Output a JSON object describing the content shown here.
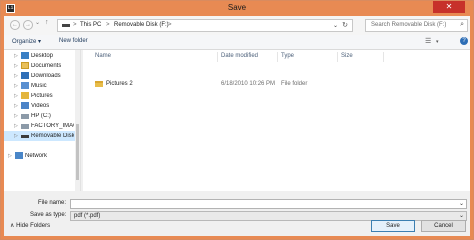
{
  "window": {
    "title": "Save",
    "app_icon": "Li",
    "close_glyph": "✕",
    "accent_color": "#e88a53",
    "close_color": "#c7312a"
  },
  "navbar": {
    "back_glyph": "←",
    "forward_glyph": "→",
    "history_glyph": "⌄",
    "up_glyph": "↑",
    "breadcrumb": [
      "This PC",
      "Removable Disk (F:)"
    ],
    "chevron": ">",
    "dropdown_glyph": "⌄",
    "refresh_glyph": "↻",
    "search_placeholder": "Search Removable Disk (F:)",
    "search_glyph": "⌕"
  },
  "commandbar": {
    "organize": "Organize ▾",
    "new_folder": "New folder",
    "view_glyph": "☰",
    "view_dropdown": "▾",
    "help_glyph": "?"
  },
  "nav_pane": {
    "expand_glyph": "▷",
    "items": [
      {
        "label": "Desktop",
        "icon": "desktop-icon"
      },
      {
        "label": "Documents",
        "icon": "documents-icon"
      },
      {
        "label": "Downloads",
        "icon": "downloads-icon"
      },
      {
        "label": "Music",
        "icon": "music-icon"
      },
      {
        "label": "Pictures",
        "icon": "pictures-icon"
      },
      {
        "label": "Videos",
        "icon": "videos-icon"
      },
      {
        "label": "HP (C:)",
        "icon": "drive-icon"
      },
      {
        "label": "FACTORY_IMAGE",
        "icon": "drive-icon"
      },
      {
        "label": "Removable Disk (F:)",
        "icon": "usb-drive-icon",
        "selected": true
      },
      {
        "label": "Network",
        "icon": "network-icon"
      }
    ]
  },
  "file_list": {
    "columns": [
      "Name",
      "Date modified",
      "Type",
      "Size"
    ],
    "rows": [
      {
        "name": "Pictures 2",
        "date": "6/18/2010 10:26 PM",
        "type": "File folder",
        "size": ""
      }
    ]
  },
  "footer": {
    "file_name_label": "File name:",
    "file_name_value": "",
    "save_as_type_label": "Save as type:",
    "save_as_type_value": "pdf (*.pdf)",
    "dropdown_glyph": "⌄",
    "hide_folders": "Hide Folders",
    "hide_glyph": "∧",
    "save_button": "Save",
    "cancel_button": "Cancel"
  }
}
